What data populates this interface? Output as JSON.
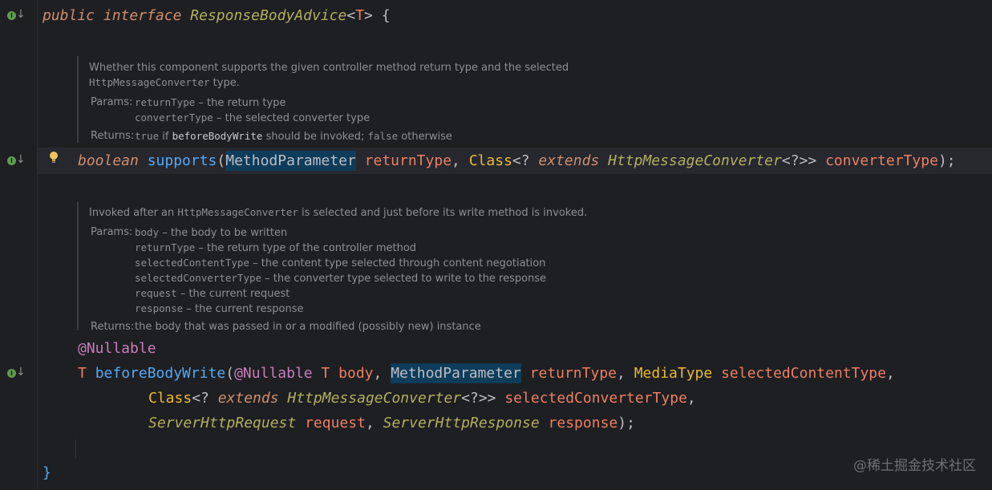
{
  "line1": {
    "kw_public": "public",
    "kw_interface": "interface",
    "name": "ResponseBodyAdvice",
    "generic_open": "<",
    "generic_T": "T",
    "generic_close": ">",
    "brace": " {"
  },
  "doc1": {
    "desc1": "Whether this component supports the given controller method return type and the selected",
    "desc2_code": "HttpMessageConverter",
    "desc2_text": " type.",
    "params_label": "Params:",
    "p1_name": "returnType",
    "p1_desc": " – the return type",
    "p2_name": "converterType",
    "p2_desc": " – the selected converter type",
    "returns_label": "Returns:",
    "ret_true": "true",
    "ret_if": " if ",
    "ret_method": "beforeBodyWrite",
    "ret_mid": " should be invoked; ",
    "ret_false": "false",
    "ret_end": " otherwise"
  },
  "line2": {
    "kw_boolean": "boolean",
    "method": "supports",
    "open": "(",
    "type1": "MethodParameter",
    "param1": "returnType",
    "comma1": ", ",
    "type2": "Class",
    "wild": "<? ",
    "kw_extends": "extends",
    "type3": "HttpMessageConverter",
    "wild2": "<?>> ",
    "param2": "converterType",
    "end": ");"
  },
  "doc2": {
    "desc_pre": "Invoked after an ",
    "desc_code": "HttpMessageConverter",
    "desc_post": " is selected and just before its write method is invoked.",
    "params_label": "Params:",
    "params": [
      {
        "name": "body",
        "desc": " – the body to be written"
      },
      {
        "name": "returnType",
        "desc": " – the return type of the controller method"
      },
      {
        "name": "selectedContentType",
        "desc": " – the content type selected through content negotiation"
      },
      {
        "name": "selectedConverterType",
        "desc": " – the converter type selected to write to the response"
      },
      {
        "name": "request",
        "desc": " – the current request"
      },
      {
        "name": "response",
        "desc": " – the current response"
      }
    ],
    "returns_label": "Returns:",
    "returns_text": "the body that was passed in or a modified (possibly new) instance"
  },
  "line3": {
    "annotation": "@Nullable"
  },
  "line4": {
    "ret_T": "T",
    "method": "beforeBodyWrite",
    "open": "(",
    "ann": "@Nullable",
    "T": "T",
    "p_body": "body",
    "comma": ", ",
    "type1": "MethodParameter",
    "p_returnType": "returnType",
    "type2": "MediaType",
    "p_sct": "selectedContentType",
    "trail": ","
  },
  "line5": {
    "type": "Class",
    "wild": "<? ",
    "kw_extends": "extends",
    "type2": "HttpMessageConverter",
    "wild2": "<?>> ",
    "param": "selectedConverterType",
    "trail": ","
  },
  "line6": {
    "type1": "ServerHttpRequest",
    "p1": "request",
    "comma": ", ",
    "type2": "ServerHttpResponse",
    "p2": "response",
    "end": ");"
  },
  "line7": {
    "brace": "}"
  },
  "watermark": "@稀土掘金技术社区",
  "colors": {
    "background": "#1e1f22",
    "keyword": "#cf8e6d",
    "class_name": "#b3ae60",
    "method": "#56a8f5",
    "parameter": "#ec7f63",
    "annotation": "#c77dbb",
    "highlight": "#0e3c5a"
  }
}
